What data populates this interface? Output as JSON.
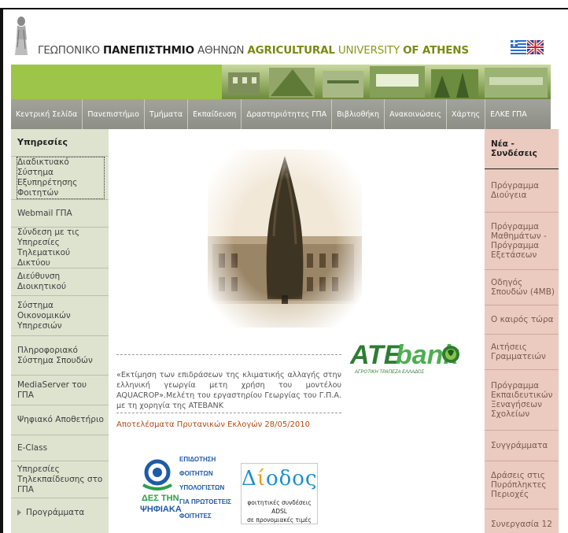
{
  "header": {
    "title_part1": "ΓΕΩΠΟΝΙΚΟ ",
    "title_part2": "ΠΑΝΕΠΙΣΤΗΜΙΟ",
    "title_part3": " ΑΘΗΝΩΝ ",
    "title_part4": "AGRICULTURAL",
    "title_part5": " UNIVERSITY ",
    "title_part6": "OF ATHENS"
  },
  "colors": {
    "strip_green": "#9cc54a",
    "nav_gray": "#98998f",
    "left_bg": "#dde3cf",
    "right_bg": "#ebcabf",
    "title_green": "#7a8a12",
    "link_orange": "#b34a12"
  },
  "nav": [
    "Κεντρική Σελίδα",
    "Πανεπιστήμιο",
    "Τμήματα",
    "Εκπαίδευση",
    "Δραστηριότητες ΓΠΑ",
    "Βιβλιοθήκη",
    "Ανακοινώσεις",
    "Χάρτης",
    "ΕΛΚΕ ΓΠΑ"
  ],
  "left": {
    "heading": "Υπηρεσίες",
    "items": [
      "Διαδικτυακό Σύστημα Εξυπηρέτησης Φοιτητών",
      "Webmail ΓΠΑ",
      "Σύνδεση με τις Υπηρεσίες Τηλεματικού Δικτύου",
      "Διεύθυνση Διοικητικού",
      "Σύστημα Οικονομικών Υπηρεσιών",
      "Πληροφοριακό Σύστημα Σπουδών",
      "MediaServer του ΓΠΑ",
      "Ψηφιακό Αποθετήριο",
      "E-Class",
      "Υπηρεσίες Τηλεκπαίδευσης στο ΓΠΑ",
      "Προγράμματα"
    ]
  },
  "center": {
    "news_text": "«Εκτίμηση των επιδράσεων της κλιματικής αλλαγής στην ελληνική γεωργία μετη χρήση του μοντέλου AQUACROP».Μελέτη του εργαστηρίου Γεωργίας του Γ.Π.Α. με τη χορηγία της ATEBANK",
    "elections_link": "Αποτελέσματα Πρυτανικών Εκλογών 28/05/2010",
    "ate_logo": {
      "word1": "ATE",
      "word2": "bank",
      "subtitle": "ΑΓΡΟΤΙΚΗ ΤΡΑΠΕΖΑ ΕΛΛΑΔΟΣ"
    },
    "digital_logo": {
      "line1": "ΕΠΙΔΟΤΗΣΗ",
      "line2": "ΦΟΙΤΗΤΩΝ",
      "line3": "ΥΠΟΛΟΓΙΣΤΩΝ",
      "line4": "ΓΙΑ ΠΡΩΤΟΕΤΕΙΣ",
      "line5": "ΦΟΙΤΗΤΕΣ",
      "left1": "ΔΕΣ ΤΗΝ",
      "left2": "ΨΗΦΙΑΚΑ"
    },
    "dias_logo": {
      "title_a": "Δ",
      "title_b": "ί",
      "title_c": "οδος",
      "line1": "φοιτητικές συνδέσεις ADSL",
      "line2": "σε προνομιακές τιμές"
    }
  },
  "right": {
    "heading": "Νέα - Συνδέσεις",
    "items": [
      "Πρόγραμμα Διούγεια",
      "Πρόγραμμα Μαθημάτων - Πρόγραμμα Εξετάσεων",
      "Οδηγός Σπουδών (4MB)",
      "Ο καιρός τώρα",
      "Αιτήσεις Γραμματειών",
      "Πρόγραμμα Εκπαιδευτικών Ξεναγήσεων Σχολείων",
      "Συγγράμματα",
      "Δράσεις στις Πυρόπληκτες Περιοχές",
      "Συνεργασία 12"
    ]
  }
}
